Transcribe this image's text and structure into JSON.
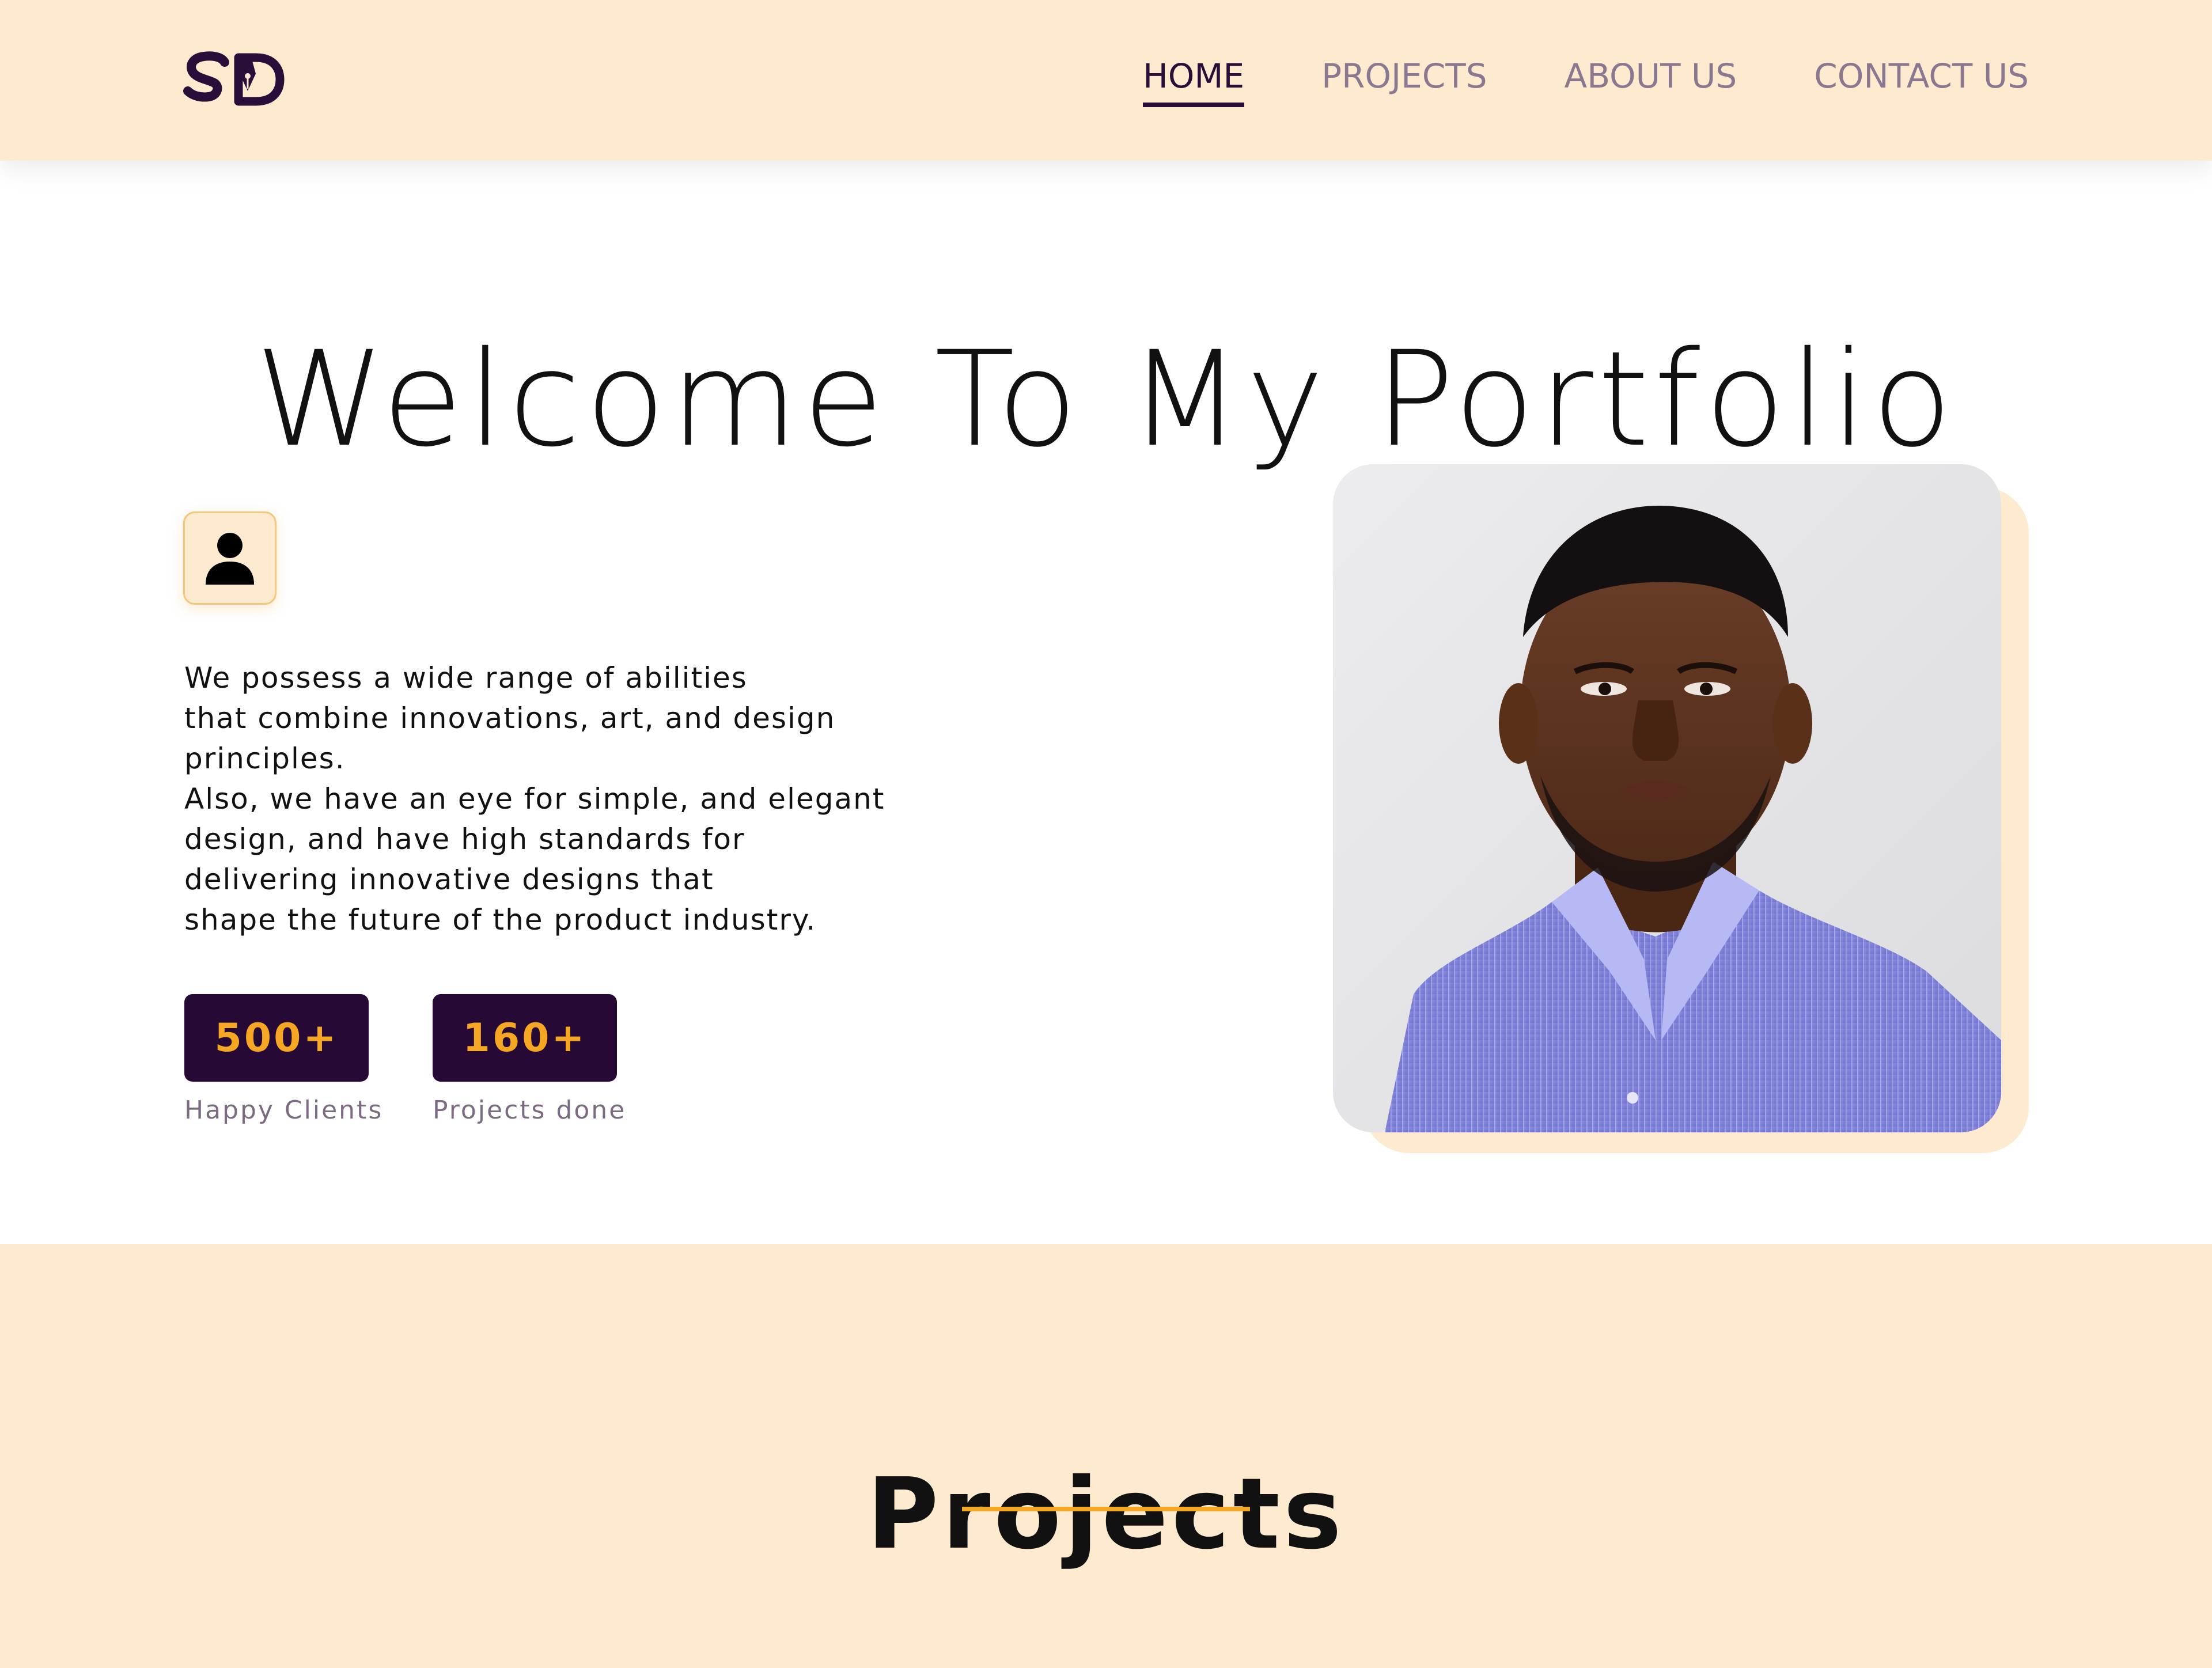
{
  "brand": {
    "logo_text": "SD",
    "logo_icon": "pen-nib-icon",
    "colors": {
      "cream": "#FEEBCF",
      "dark_purple": "#260A35",
      "accent_orange": "#F5A623",
      "muted_text": "#7C6A82"
    }
  },
  "nav": {
    "items": [
      {
        "label": "HOME",
        "active": true
      },
      {
        "label": "PROJECTS",
        "active": false
      },
      {
        "label": "ABOUT US",
        "active": false
      },
      {
        "label": "CONTACT US",
        "active": false
      }
    ]
  },
  "hero": {
    "title": "Welcome To My Portfolio",
    "avatar_icon": "user-icon",
    "bio_lines": [
      "We possess a wide range of abilities",
      "that combine innovations, art, and design",
      "principles.",
      "Also, we have an eye for simple, and elegant",
      "design, and have high standards for",
      "delivering innovative designs that",
      "shape the future of the product industry."
    ],
    "stats": [
      {
        "value": "500+",
        "label": "Happy Clients"
      },
      {
        "value": "160+",
        "label": "Projects done"
      }
    ],
    "portrait": "profile-portrait"
  },
  "projects": {
    "title": "Projects"
  }
}
